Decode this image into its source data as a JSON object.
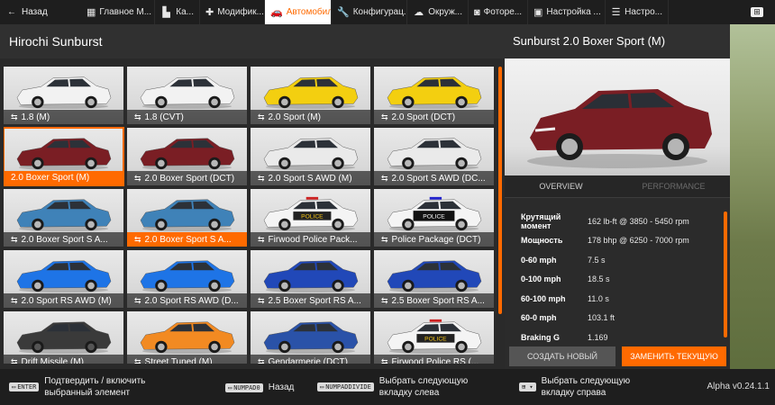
{
  "topbar": {
    "back_label": "Назад",
    "tabs": [
      {
        "label": "Главное М...",
        "icon": "home-icon"
      },
      {
        "label": "Ка...",
        "icon": "map-icon"
      },
      {
        "label": "Модифик...",
        "icon": "puzzle-icon"
      },
      {
        "label": "Автомобили",
        "icon": "car-icon",
        "active": true
      },
      {
        "label": "Конфигурац...",
        "icon": "wrench-icon"
      },
      {
        "label": "Окруж...",
        "icon": "weather-icon"
      },
      {
        "label": "Фоторе...",
        "icon": "camera-icon"
      },
      {
        "label": "Настройка ...",
        "icon": "window-icon"
      },
      {
        "label": "Настро...",
        "icon": "sliders-icon"
      }
    ],
    "right_button": "⊞"
  },
  "left": {
    "title": "Hirochi Sunburst",
    "cars": [
      {
        "label": "1.8 (M)",
        "color": "#f2f2f2",
        "extra": "none"
      },
      {
        "label": "1.8 (CVT)",
        "color": "#f2f2f2",
        "extra": "none"
      },
      {
        "label": "2.0 Sport (M)",
        "color": "#f3cf10",
        "extra": "none"
      },
      {
        "label": "2.0 Sport (DCT)",
        "color": "#f3cf10",
        "extra": "none"
      },
      {
        "label": "2.0 Boxer Sport (M)",
        "color": "#7a1e24",
        "extra": "none",
        "selected": true
      },
      {
        "label": "2.0 Boxer Sport (DCT)",
        "color": "#7a1e24",
        "extra": "none"
      },
      {
        "label": "2.0 Sport S AWD (M)",
        "color": "#eaeaea",
        "extra": "none"
      },
      {
        "label": "2.0 Sport S AWD (DC...",
        "color": "#eaeaea",
        "extra": "none"
      },
      {
        "label": "2.0 Boxer Sport S A...",
        "color": "#3f82b8",
        "extra": "none"
      },
      {
        "label": "2.0 Boxer Sport S A...",
        "color": "#3f82b8",
        "extra": "none",
        "highlight": true
      },
      {
        "label": "Firwood Police Pack...",
        "color": "#f4f4f4",
        "extra": "police"
      },
      {
        "label": "Police Package (DCT)",
        "color": "#f4f4f4",
        "extra": "police-dark"
      },
      {
        "label": "2.0 Sport RS AWD (M)",
        "color": "#1e74e6",
        "extra": "none"
      },
      {
        "label": "2.0 Sport RS AWD (D...",
        "color": "#1e74e6",
        "extra": "none"
      },
      {
        "label": "2.5 Boxer Sport RS A...",
        "color": "#2148b8",
        "extra": "none"
      },
      {
        "label": "2.5 Boxer Sport RS A...",
        "color": "#2148b8",
        "extra": "none"
      },
      {
        "label": "Drift Missile (M)",
        "color": "#3a3a3a",
        "extra": "none"
      },
      {
        "label": "Street Tuned (M)",
        "color": "#f28a22",
        "extra": "none"
      },
      {
        "label": "Gendarmerie (DCT)",
        "color": "#2a52a8",
        "extra": "none"
      },
      {
        "label": "Firwood Police RS (...",
        "color": "#f4f4f4",
        "extra": "police"
      }
    ]
  },
  "right": {
    "title": "Sunburst 2.0 Boxer Sport (M)",
    "preview_color": "#7a1e24",
    "subtabs": [
      "OVERVIEW",
      "PERFORMANCE"
    ],
    "stats": [
      {
        "key": "Крутящий момент",
        "value": "162 lb-ft @ 3850 - 5450 rpm"
      },
      {
        "key": "Мощность",
        "value": "178 bhp @ 6250 - 7000 rpm"
      },
      {
        "key": "0-60 mph",
        "value": "7.5 s"
      },
      {
        "key": "0-100 mph",
        "value": "18.5 s"
      },
      {
        "key": "60-100 mph",
        "value": "11.0 s"
      },
      {
        "key": "60-0 mph",
        "value": "103.1 ft"
      },
      {
        "key": "Braking G",
        "value": "1.169"
      }
    ],
    "btn_new": "СОЗДАТЬ НОВЫЙ",
    "btn_replace": "ЗАМЕНИТЬ ТЕКУЩУЮ"
  },
  "bottom": {
    "hints": [
      {
        "key": "ENTER",
        "text": "Подтвердить / включить выбранный элемент"
      },
      {
        "key": "NUMPAD0",
        "text": "Назад"
      },
      {
        "key": "NUMPADDIVIDE",
        "text": "Выбрать следующую вкладку слева"
      },
      {
        "key": "⊞ ▾",
        "text": "Выбрать следующую вкладку справа"
      }
    ],
    "version": "Alpha v0.24.1.1"
  },
  "colors": {
    "accent": "#ff6a00",
    "panel": "#2a2a2a",
    "bar": "#1e1e1e"
  }
}
